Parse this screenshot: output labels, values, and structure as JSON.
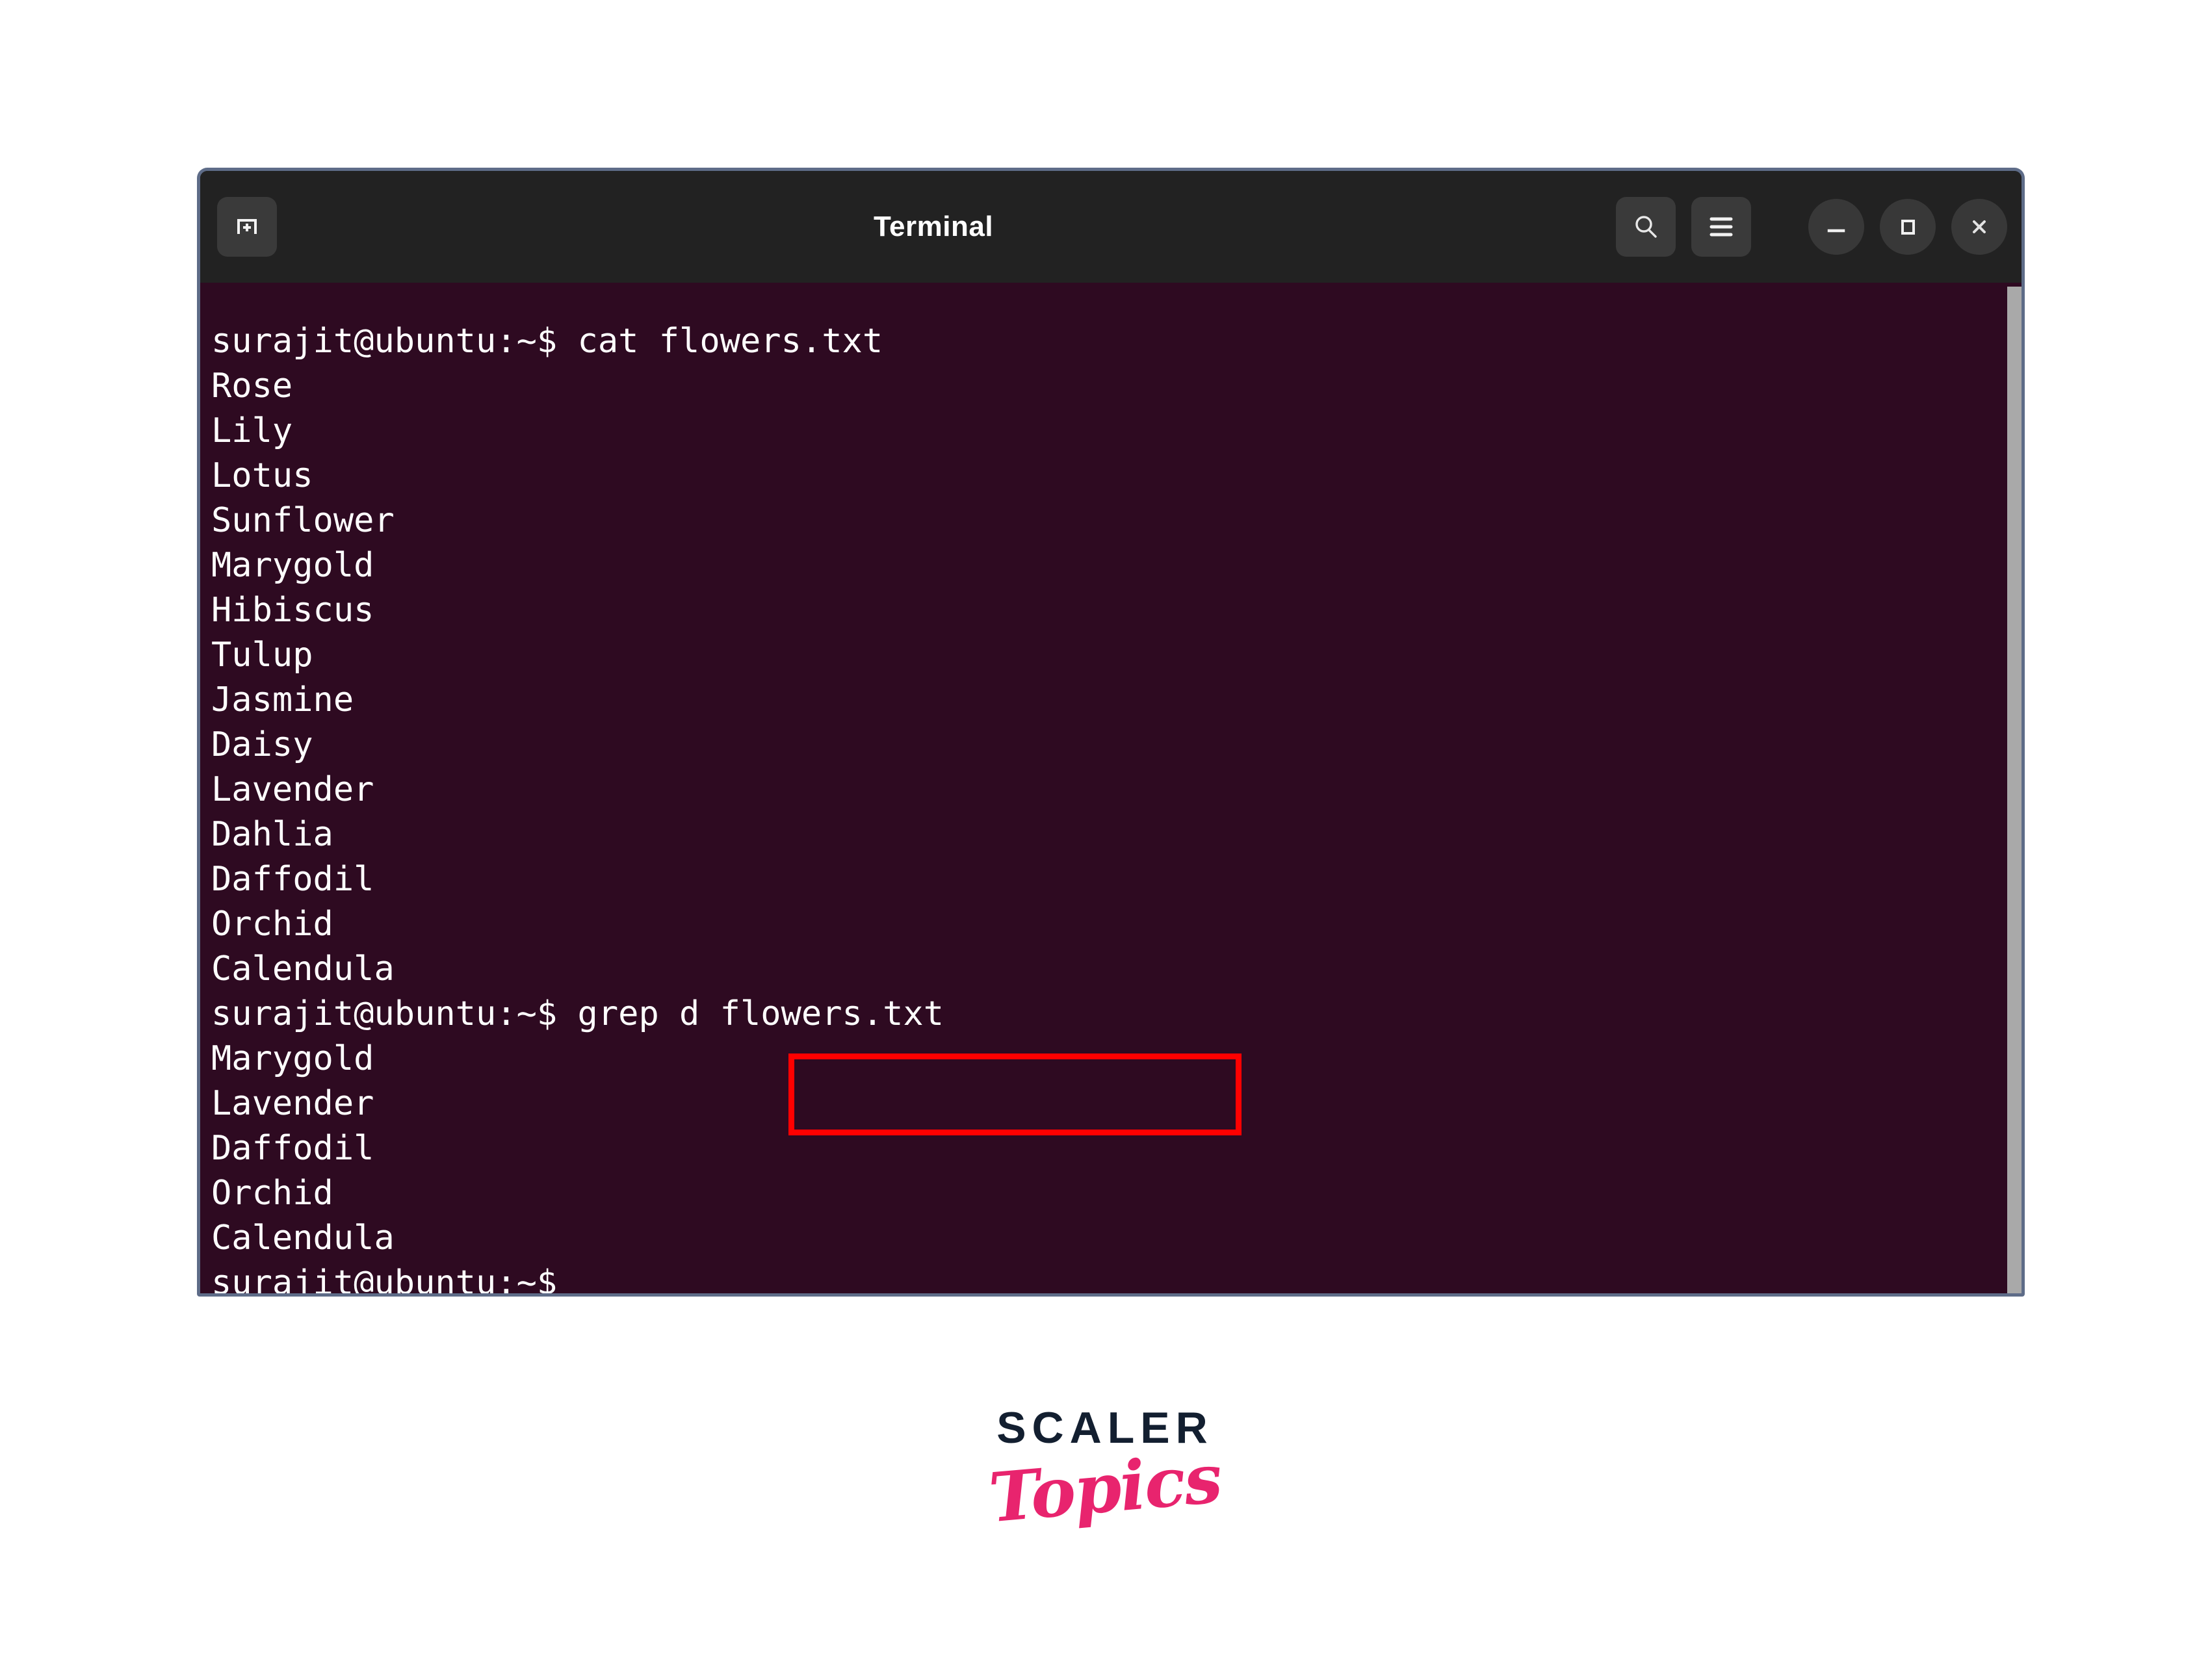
{
  "window": {
    "title": "Terminal",
    "colors": {
      "titlebar_bg": "#222222",
      "terminal_bg": "#2e0a21",
      "window_border": "#5e6c88",
      "text": "#ffffff",
      "highlight_box": "#ff0000",
      "scrollbar": "#a9a9a9"
    },
    "titlebar": {
      "new_tab_icon": "new-tab-plus-icon",
      "search_icon": "search-icon",
      "menu_icon": "hamburger-menu-icon",
      "minimize_icon": "minimize-icon",
      "maximize_icon": "maximize-icon",
      "close_icon": "close-icon"
    }
  },
  "terminal": {
    "prompt": "surajit@ubuntu:~$",
    "lines": [
      {
        "type": "prompt",
        "prompt": "surajit@ubuntu:~$ ",
        "command": "cat flowers.txt"
      },
      {
        "type": "output",
        "text": "Rose"
      },
      {
        "type": "output",
        "text": "Lily"
      },
      {
        "type": "output",
        "text": "Lotus"
      },
      {
        "type": "output",
        "text": "Sunflower"
      },
      {
        "type": "output",
        "text": "Marygold"
      },
      {
        "type": "output",
        "text": "Hibiscus"
      },
      {
        "type": "output",
        "text": "Tulup"
      },
      {
        "type": "output",
        "text": "Jasmine"
      },
      {
        "type": "output",
        "text": "Daisy"
      },
      {
        "type": "output",
        "text": "Lavender"
      },
      {
        "type": "output",
        "text": "Dahlia"
      },
      {
        "type": "output",
        "text": "Daffodil"
      },
      {
        "type": "output",
        "text": "Orchid"
      },
      {
        "type": "output",
        "text": "Calendula"
      },
      {
        "type": "prompt",
        "prompt": "surajit@ubuntu:~$ ",
        "command": "grep d flowers.txt",
        "highlighted": true
      },
      {
        "type": "output",
        "text": "Marygold"
      },
      {
        "type": "output",
        "text": "Lavender"
      },
      {
        "type": "output",
        "text": "Daffodil"
      },
      {
        "type": "output",
        "text": "Orchid"
      },
      {
        "type": "output",
        "text": "Calendula"
      },
      {
        "type": "prompt",
        "prompt": "surajit@ubuntu:~$",
        "command": ""
      }
    ],
    "full_text": "surajit@ubuntu:~$ cat flowers.txt\nRose\nLily\nLotus\nSunflower\nMarygold\nHibiscus\nTulup\nJasmine\nDaisy\nLavender\nDahlia\nDaffodil\nOrchid\nCalendula\nsurajit@ubuntu:~$ grep d flowers.txt\nMarygold\nLavender\nDaffodil\nOrchid\nCalendula\nsurajit@ubuntu:~$"
  },
  "annotation": {
    "highlighted_command": "grep d flowers.txt"
  },
  "logo": {
    "primary": "SCALER",
    "secondary": "Topics",
    "primary_color": "#131f30",
    "secondary_color": "#e8246e"
  }
}
